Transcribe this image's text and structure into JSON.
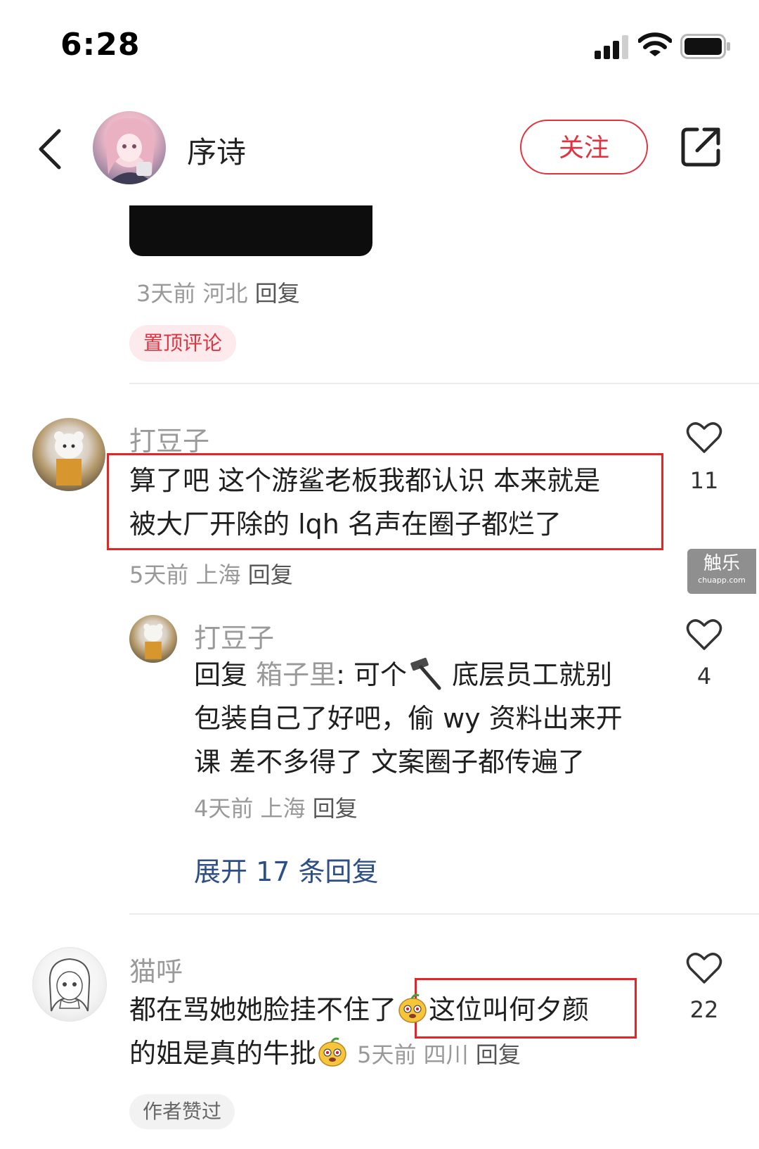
{
  "status_bar": {
    "time": "6:28"
  },
  "header": {
    "name": "序诗",
    "follow_label": "关注"
  },
  "pinned": {
    "meta": {
      "time": "3天前",
      "location": "河北",
      "reply": "回复"
    },
    "badge": "置顶评论"
  },
  "comments": [
    {
      "username": "打豆子",
      "lines": [
        "算了吧 这个游鲨老板我都认识  本来就是",
        "被大厂开除的 lqh 名声在圈子都烂了"
      ],
      "meta": {
        "time": "5天前",
        "location": "上海",
        "reply": "回复"
      },
      "likes": "11",
      "sub_reply": {
        "username": "打豆子",
        "prefix": "回复",
        "reply_to": "箱子里",
        "line1_a": ": 可个",
        "line1_b": " 底层员工就别",
        "line2": "包装自己了好吧，偷 wy 资料出来开",
        "line3": "课 差不多得了 文案圈子都传遍了",
        "meta": {
          "time": "4天前",
          "location": "上海",
          "reply": "回复"
        },
        "likes": "4"
      },
      "expand_label": "展开 17 条回复"
    },
    {
      "username": "猫呼",
      "line1_a": "都在骂她她脸挂不住了",
      "line1_b": "这位叫何夕颜",
      "line2": "的姐是真的牛批",
      "meta": {
        "time": "5天前",
        "location": "四川",
        "reply": "回复"
      },
      "likes": "22",
      "badge": "作者赞过"
    }
  ],
  "watermark": {
    "brand": "触乐",
    "site": "chuapp.com"
  },
  "colors": {
    "accent_red": "#e2323f",
    "link_blue": "#2d4f86",
    "muted": "#9a9a9a"
  }
}
